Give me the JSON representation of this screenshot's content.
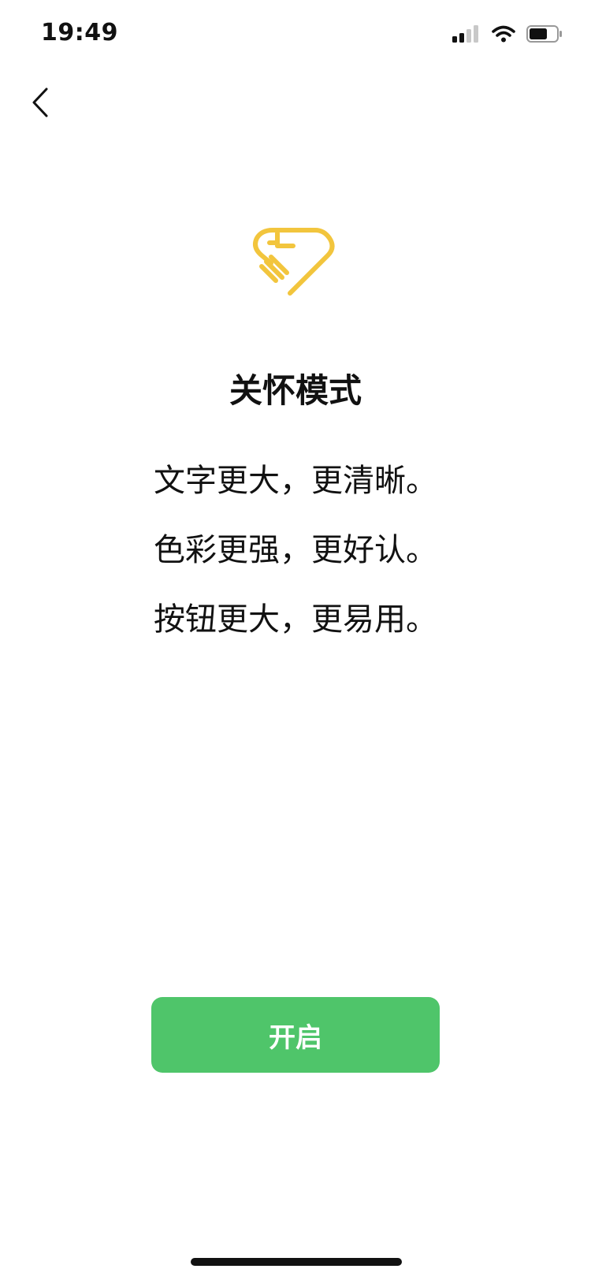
{
  "status_bar": {
    "time": "19:49"
  },
  "nav": {
    "back_icon": "chevron-left-icon"
  },
  "hero": {
    "icon": "care-mode-heart-hand-icon",
    "icon_color": "#F2C53D"
  },
  "content": {
    "title": "关怀模式",
    "lines": [
      "文字更大，更清晰。",
      "色彩更强，更好认。",
      "按钮更大，更易用。"
    ]
  },
  "actions": {
    "enable_label": "开启",
    "enable_color": "#4FC56A"
  }
}
